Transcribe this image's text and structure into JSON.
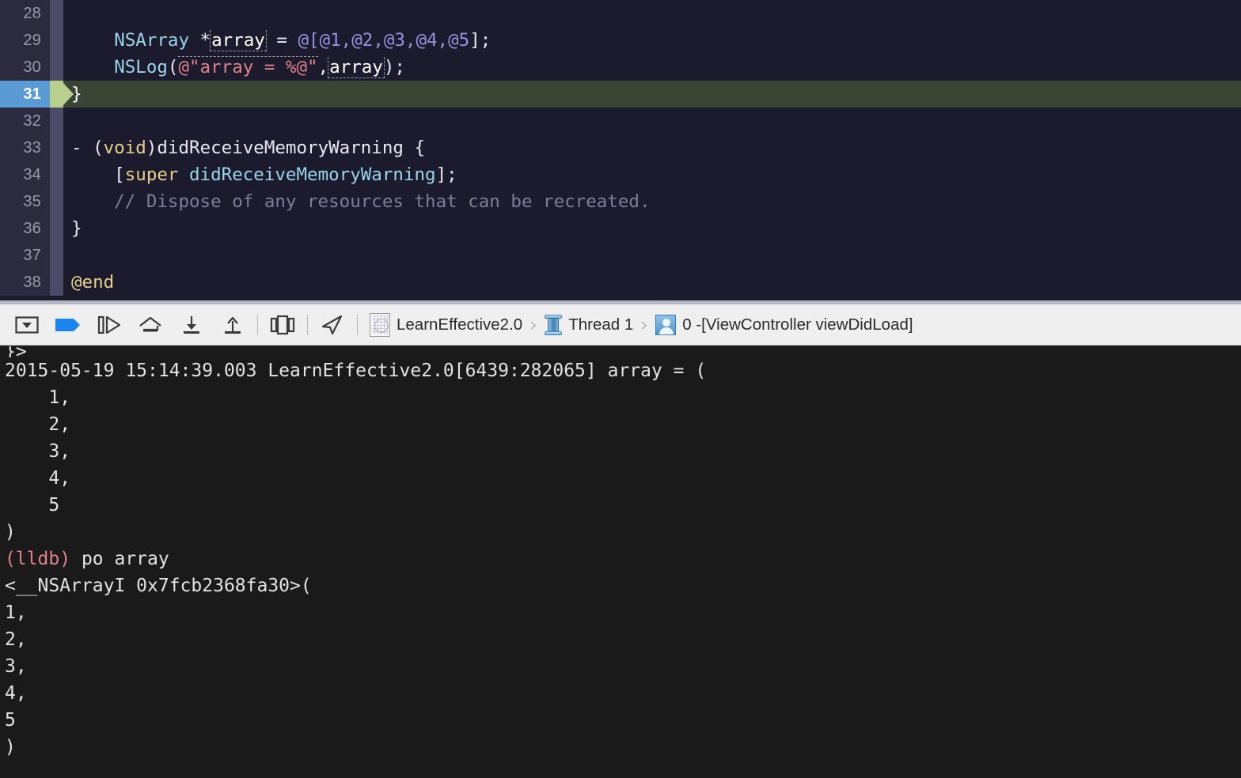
{
  "editor": {
    "name": "source-editor",
    "language": "Objective-C",
    "current_line": 31,
    "first_visible_line": 28,
    "lines": [
      {
        "num": "28",
        "tokens": []
      },
      {
        "num": "29",
        "tokens": [
          {
            "text": "    ",
            "cls": "t-plain"
          },
          {
            "text": "NSArray",
            "cls": "t-type"
          },
          {
            "text": " *",
            "cls": "t-plain"
          },
          {
            "text": "array",
            "cls": "t-sel"
          },
          {
            "text": " = ",
            "cls": "t-plain"
          },
          {
            "text": "@[",
            "cls": "t-num"
          },
          {
            "text": "@1",
            "cls": "t-num"
          },
          {
            "text": ",",
            "cls": "t-num"
          },
          {
            "text": "@2",
            "cls": "t-num"
          },
          {
            "text": ",",
            "cls": "t-num"
          },
          {
            "text": "@3",
            "cls": "t-num"
          },
          {
            "text": ",",
            "cls": "t-num"
          },
          {
            "text": "@4",
            "cls": "t-num"
          },
          {
            "text": ",",
            "cls": "t-num"
          },
          {
            "text": "@5",
            "cls": "t-num"
          },
          {
            "text": "];",
            "cls": "t-plain"
          }
        ]
      },
      {
        "num": "30",
        "tokens": [
          {
            "text": "    ",
            "cls": "t-plain"
          },
          {
            "text": "NSLog",
            "cls": "t-fn"
          },
          {
            "text": "(",
            "cls": "t-plain"
          },
          {
            "text": "@\"array = %@\"",
            "cls": "t-str t-seltop"
          },
          {
            "text": ",",
            "cls": "t-plain"
          },
          {
            "text": "array",
            "cls": "t-sel"
          },
          {
            "text": ");",
            "cls": "t-plain"
          }
        ]
      },
      {
        "num": "31",
        "current": true,
        "tokens": [
          {
            "text": "}",
            "cls": "t-white"
          }
        ]
      },
      {
        "num": "32",
        "tokens": []
      },
      {
        "num": "33",
        "tokens": [
          {
            "text": "- (",
            "cls": "t-plain"
          },
          {
            "text": "void",
            "cls": "t-kw"
          },
          {
            "text": ")didReceiveMemoryWarning {",
            "cls": "t-plain"
          }
        ]
      },
      {
        "num": "34",
        "tokens": [
          {
            "text": "    [",
            "cls": "t-plain"
          },
          {
            "text": "super",
            "cls": "t-kw"
          },
          {
            "text": " ",
            "cls": "t-plain"
          },
          {
            "text": "didReceiveMemoryWarning",
            "cls": "t-fn"
          },
          {
            "text": "];",
            "cls": "t-plain"
          }
        ]
      },
      {
        "num": "35",
        "tokens": [
          {
            "text": "    // Dispose of any resources that can be recreated.",
            "cls": "t-com"
          }
        ]
      },
      {
        "num": "36",
        "tokens": [
          {
            "text": "}",
            "cls": "t-plain"
          }
        ]
      },
      {
        "num": "37",
        "tokens": []
      },
      {
        "num": "38",
        "tokens": [
          {
            "text": "@end",
            "cls": "t-kw"
          }
        ]
      }
    ]
  },
  "toolbar": {
    "icons": [
      {
        "name": "hide-debug-area-icon",
        "label": "Hide Debug Area"
      },
      {
        "name": "breakpoints-toggle-icon",
        "label": "Activate Breakpoints",
        "active": true
      },
      {
        "name": "continue-program-icon",
        "label": "Continue program execution"
      },
      {
        "name": "step-over-icon",
        "label": "Step over"
      },
      {
        "name": "step-into-icon",
        "label": "Step into"
      },
      {
        "name": "step-out-icon",
        "label": "Step out"
      },
      {
        "name": "view-debugging-icon",
        "label": "Debug View Hierarchy"
      },
      {
        "name": "simulate-location-icon",
        "label": "Simulate Location"
      }
    ],
    "breadcrumb": {
      "process": "LearnEffective2.0",
      "thread": "Thread 1",
      "frame": "0 -[ViewController viewDidLoad]",
      "separator": "›"
    },
    "colors": {
      "toolbar_bg": "#efefef",
      "accent_blue": "#2a7cf0",
      "divider": "#b5b6c4"
    }
  },
  "console": {
    "name": "debug-console",
    "lines": [
      {
        "text": "}>",
        "cls": "c-out",
        "clipped": true
      },
      {
        "text": "2015-05-19 15:14:39.003 LearnEffective2.0[6439:282065] array = (",
        "cls": "c-out"
      },
      {
        "text": "    1,",
        "cls": "c-out"
      },
      {
        "text": "    2,",
        "cls": "c-out"
      },
      {
        "text": "    3,",
        "cls": "c-out"
      },
      {
        "text": "    4,",
        "cls": "c-out"
      },
      {
        "text": "    5",
        "cls": "c-out"
      },
      {
        "text": ")",
        "cls": "c-out"
      },
      {
        "prompt": "(lldb) ",
        "text": "po array",
        "cls": "c-out"
      },
      {
        "text": "<__NSArrayI 0x7fcb2368fa30>(",
        "cls": "c-out"
      },
      {
        "text": "1,",
        "cls": "c-out"
      },
      {
        "text": "2,",
        "cls": "c-out"
      },
      {
        "text": "3,",
        "cls": "c-out"
      },
      {
        "text": "4,",
        "cls": "c-out"
      },
      {
        "text": "5",
        "cls": "c-out"
      },
      {
        "text": ")",
        "cls": "c-out"
      }
    ],
    "prompt_label": "(lldb)",
    "command": "po array",
    "colors": {
      "bg": "#1a1a1a",
      "text": "#e3e3e3",
      "prompt": "#e0818a"
    }
  }
}
